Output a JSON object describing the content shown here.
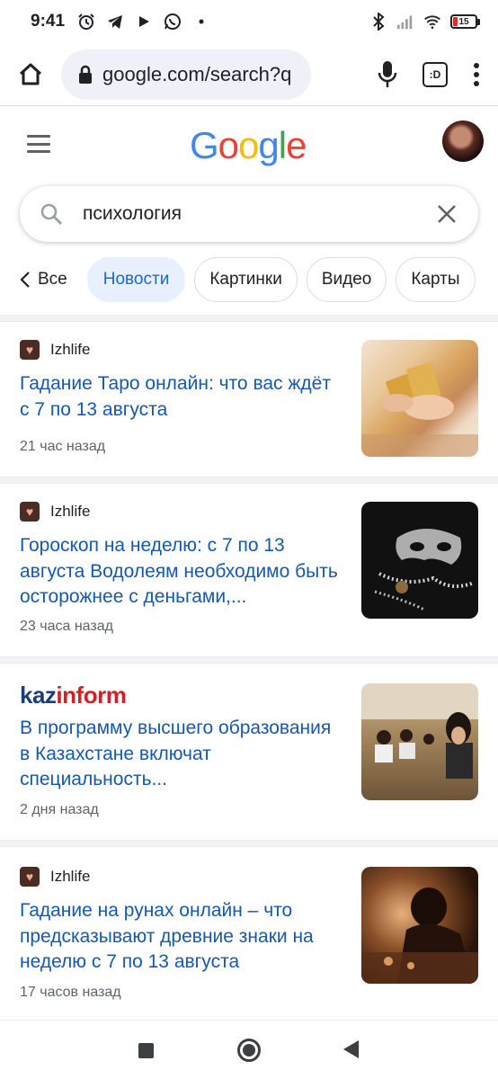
{
  "status_bar": {
    "time": "9:41",
    "left_icons": [
      "alarm-icon",
      "telegram-icon",
      "play-icon",
      "whatsapp-icon",
      "dot-icon"
    ],
    "right_icons": [
      "bluetooth-icon",
      "signal-icon",
      "wifi-icon",
      "battery-icon"
    ],
    "battery_level": "15",
    "battery_color": "#d93025"
  },
  "browser": {
    "url": "google.com/search?q",
    "tabs_label": ":D"
  },
  "google": {
    "logo_letters": [
      "G",
      "o",
      "o",
      "g",
      "l",
      "e"
    ],
    "logo_colors": [
      "#4285f4",
      "#ea4335",
      "#fbbc05",
      "#4285f4",
      "#34a853",
      "#ea4335"
    ]
  },
  "search": {
    "query": "психология"
  },
  "chips": {
    "back_label": "Все",
    "items": [
      {
        "label": "Новости",
        "active": true
      },
      {
        "label": "Картинки",
        "active": false
      },
      {
        "label": "Видео",
        "active": false
      },
      {
        "label": "Карты",
        "active": false
      }
    ]
  },
  "results": [
    {
      "source": "Izhlife",
      "title": "Гадание Таро онлайн: что вас ждёт с 7 по 13 августа",
      "time": "21 час назад"
    },
    {
      "source": "Izhlife",
      "title": "Гороскоп на неделю: с 7 по 13 августа Водолеям необходимо быть осторожнее с деньгами,...",
      "time": "23 часа назад"
    },
    {
      "source": "kazinform",
      "source_parts": [
        "kaz",
        "inf",
        "o",
        "rm"
      ],
      "title": "В программу высшего образования в Казахстане включат специальность...",
      "time": "2 дня назад"
    },
    {
      "source": "Izhlife",
      "title": "Гадание на рунах онлайн – что предсказывают древние знаки на неделю с 7 по 13 августа",
      "time": "17 часов назад"
    }
  ],
  "colors": {
    "link": "#1558b0",
    "chip_active_bg": "#e8f0fe",
    "chip_active_text": "#1967d2",
    "kazinform_blue": "#1a3d7c",
    "kazinform_red": "#d32027"
  }
}
